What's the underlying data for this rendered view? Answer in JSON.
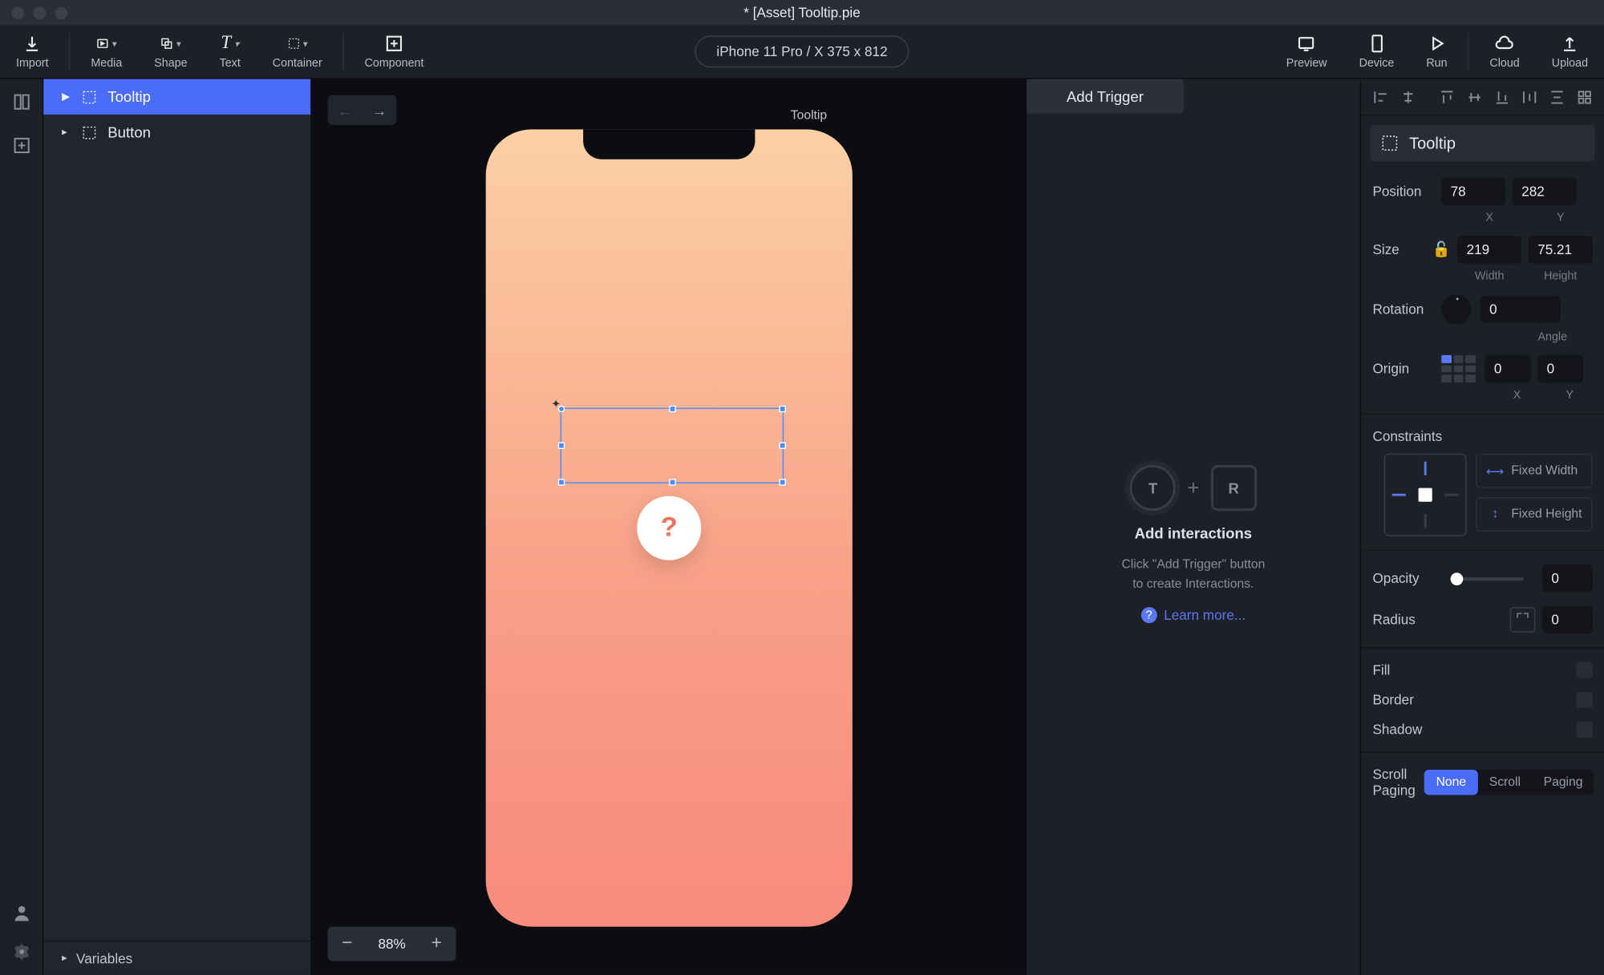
{
  "window": {
    "title": "* [Asset] Tooltip.pie"
  },
  "toolbar": {
    "left": [
      {
        "key": "import",
        "label": "Import"
      },
      {
        "key": "media",
        "label": "Media"
      },
      {
        "key": "shape",
        "label": "Shape"
      },
      {
        "key": "text",
        "label": "Text"
      },
      {
        "key": "container",
        "label": "Container"
      },
      {
        "key": "component",
        "label": "Component"
      }
    ],
    "device": "iPhone 11 Pro / X  375 x 812",
    "right": [
      {
        "key": "preview",
        "label": "Preview"
      },
      {
        "key": "device",
        "label": "Device"
      },
      {
        "key": "run",
        "label": "Run"
      },
      {
        "key": "cloud",
        "label": "Cloud"
      },
      {
        "key": "upload",
        "label": "Upload"
      }
    ]
  },
  "layers": {
    "items": [
      {
        "label": "Tooltip",
        "selected": true
      },
      {
        "label": "Button",
        "selected": false
      }
    ],
    "footer": "Variables"
  },
  "canvas": {
    "label": "Tooltip",
    "zoom": "88%",
    "question_mark": "?"
  },
  "interactions": {
    "add_trigger": "Add Trigger",
    "t_label": "T",
    "r_label": "R",
    "title": "Add interactions",
    "desc1": "Click \"Add Trigger\" button",
    "desc2": "to create Interactions.",
    "learn_more": "Learn more..."
  },
  "inspector": {
    "selected_name": "Tooltip",
    "position": {
      "label": "Position",
      "x": "78",
      "y": "282",
      "xl": "X",
      "yl": "Y"
    },
    "size": {
      "label": "Size",
      "w": "219",
      "h": "75.21",
      "wl": "Width",
      "hl": "Height"
    },
    "rotation": {
      "label": "Rotation",
      "value": "0",
      "sub": "Angle"
    },
    "origin": {
      "label": "Origin",
      "x": "0",
      "y": "0",
      "xl": "X",
      "yl": "Y"
    },
    "constraints": {
      "label": "Constraints",
      "fixed_w": "Fixed Width",
      "fixed_h": "Fixed Height"
    },
    "opacity": {
      "label": "Opacity",
      "value": "0"
    },
    "radius": {
      "label": "Radius",
      "value": "0"
    },
    "fill": {
      "label": "Fill"
    },
    "border": {
      "label": "Border"
    },
    "shadow": {
      "label": "Shadow"
    },
    "scroll_paging": {
      "label": "Scroll Paging",
      "tabs": [
        "None",
        "Scroll",
        "Paging"
      ],
      "active": "None"
    }
  }
}
